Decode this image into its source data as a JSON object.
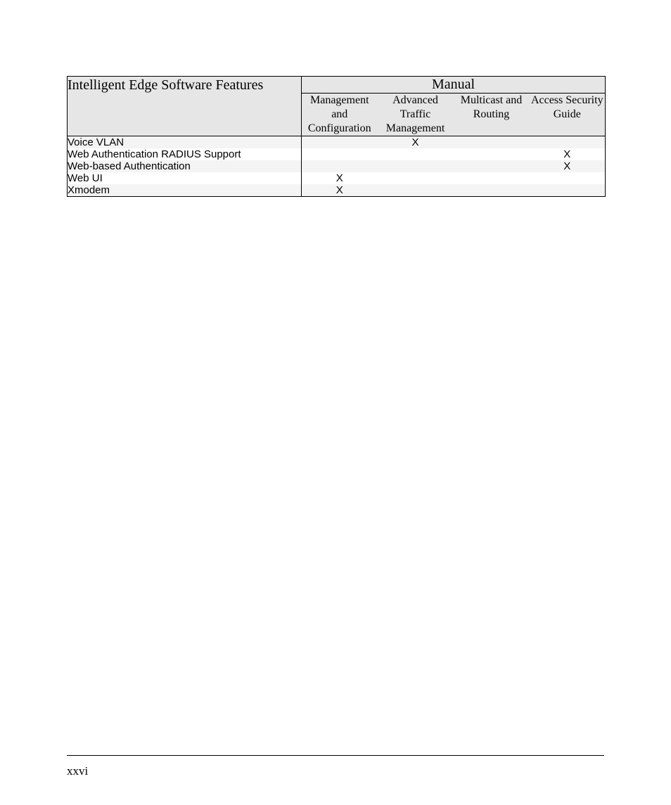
{
  "table": {
    "title_left": "Intelligent Edge Software Features",
    "title_right": "Manual",
    "columns": [
      "Management and Configuration",
      "Advanced Traffic Management",
      "Multicast and Routing",
      "Access Security Guide"
    ],
    "rows": [
      {
        "feature": "Voice VLAN",
        "marks": [
          "",
          "X",
          "",
          ""
        ]
      },
      {
        "feature": "Web Authentication RADIUS Support",
        "marks": [
          "",
          "",
          "",
          "X"
        ]
      },
      {
        "feature": "Web-based Authentication",
        "marks": [
          "",
          "",
          "",
          "X"
        ]
      },
      {
        "feature": "Web UI",
        "marks": [
          "X",
          "",
          "",
          ""
        ]
      },
      {
        "feature": "Xmodem",
        "marks": [
          "X",
          "",
          "",
          ""
        ]
      }
    ]
  },
  "page_number": "xxvi"
}
